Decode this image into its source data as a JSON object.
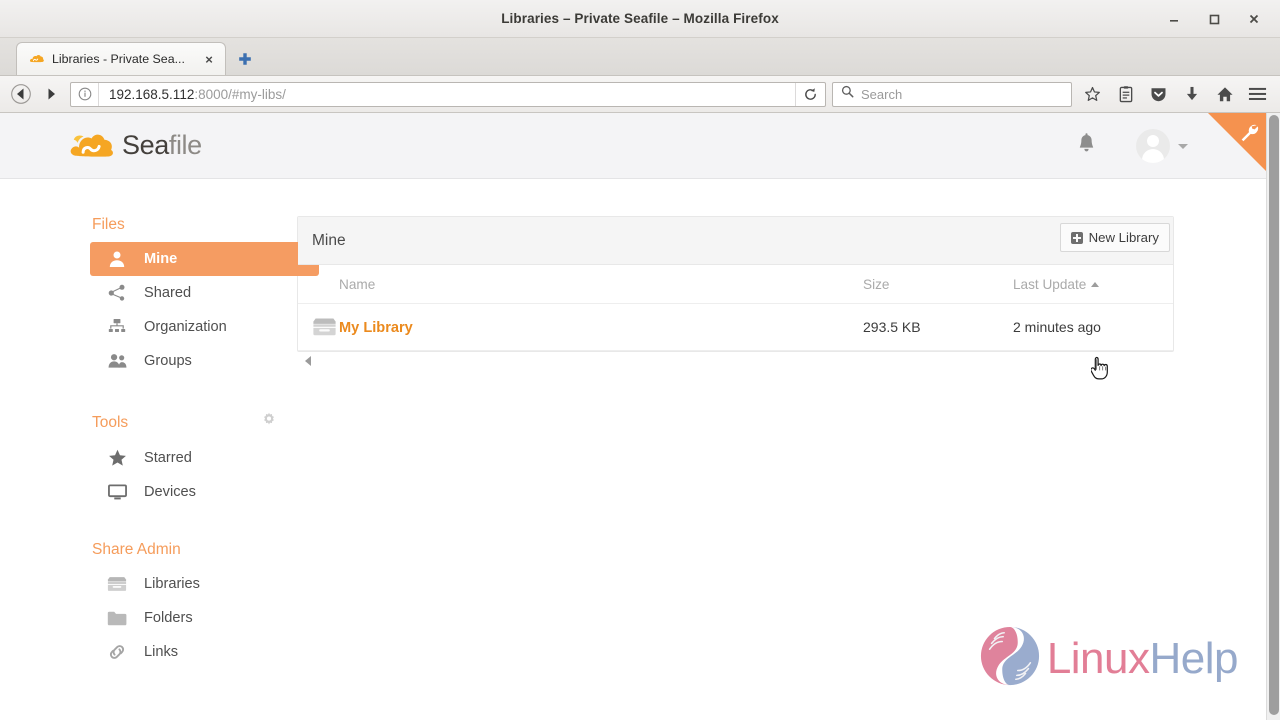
{
  "window": {
    "title": "Libraries – Private Seafile – Mozilla Firefox",
    "minimize_label": "minimize-window",
    "maximize_label": "maximize-window",
    "close_label": "close-window"
  },
  "browser": {
    "tab": {
      "title": "Libraries - Private Sea...",
      "close_label": "×",
      "favicon": "seafile-cloud-icon"
    },
    "new_tab_label": "new-tab-icon",
    "back_label": "back-icon",
    "forward_label": "forward-icon",
    "url": {
      "host": "192.168.5.112",
      "rest": ":8000/#my-libs/",
      "identity_icon": "info-icon",
      "reload_icon": "reload-icon"
    },
    "search": {
      "placeholder": "Search",
      "icon": "search-icon"
    },
    "toolbar_icons": [
      {
        "name": "bookmark-star-icon",
        "glyph": "☆"
      },
      {
        "name": "library-icon",
        "glyph": "▤"
      },
      {
        "name": "pocket-icon",
        "glyph": "⬟"
      },
      {
        "name": "downloads-icon",
        "glyph": "⬇"
      },
      {
        "name": "home-icon",
        "glyph": "⌂"
      },
      {
        "name": "menu-hamburger-icon",
        "glyph": "☰"
      }
    ]
  },
  "app": {
    "logo": {
      "sea": "Sea",
      "file": "file"
    },
    "notifications_icon": "bell-icon",
    "avatar_icon": "user-avatar-icon",
    "admin_ribbon_icon": "wrench-icon"
  },
  "sidebar": {
    "groups": [
      {
        "title": "Files",
        "items": [
          {
            "label": "Mine",
            "icon": "user-icon",
            "active": true
          },
          {
            "label": "Shared",
            "icon": "share-nodes-icon",
            "active": false
          },
          {
            "label": "Organization",
            "icon": "org-chart-icon",
            "active": false
          },
          {
            "label": "Groups",
            "icon": "users-group-icon",
            "active": false,
            "arrow": true
          }
        ]
      },
      {
        "title": "Tools",
        "action_icon": "gear-icon",
        "items": [
          {
            "label": "Starred",
            "icon": "star-icon",
            "active": false
          },
          {
            "label": "Devices",
            "icon": "monitor-icon",
            "active": false
          }
        ]
      },
      {
        "title": "Share Admin",
        "items": [
          {
            "label": "Libraries",
            "icon": "library-box-icon",
            "active": false
          },
          {
            "label": "Folders",
            "icon": "folder-icon",
            "active": false
          },
          {
            "label": "Links",
            "icon": "link-chain-icon",
            "active": false
          }
        ]
      }
    ]
  },
  "main": {
    "panel_title": "Mine",
    "new_library_button": "New Library",
    "new_library_icon": "plus-square-icon",
    "columns": [
      "Name",
      "Size",
      "Last Update"
    ],
    "sort_column": "Last Update",
    "sort_direction": "asc",
    "rows": [
      {
        "icon": "library-box-icon",
        "name": "My Library",
        "size": "293.5 KB",
        "last_update": "2 minutes ago"
      }
    ]
  },
  "watermark": {
    "part1": "Linux",
    "part2": "Help",
    "icon": "linuxhelp-hands-logo"
  },
  "colors": {
    "accent_orange": "#f59c62",
    "link_orange": "#eb8a1e",
    "heading_orange": "#f59c5b",
    "header_bg": "#f4f4f6",
    "panel_head_bg": "#f5f5f5",
    "watermark_pink": "#e0758f",
    "watermark_blue": "#8fa3c8"
  }
}
